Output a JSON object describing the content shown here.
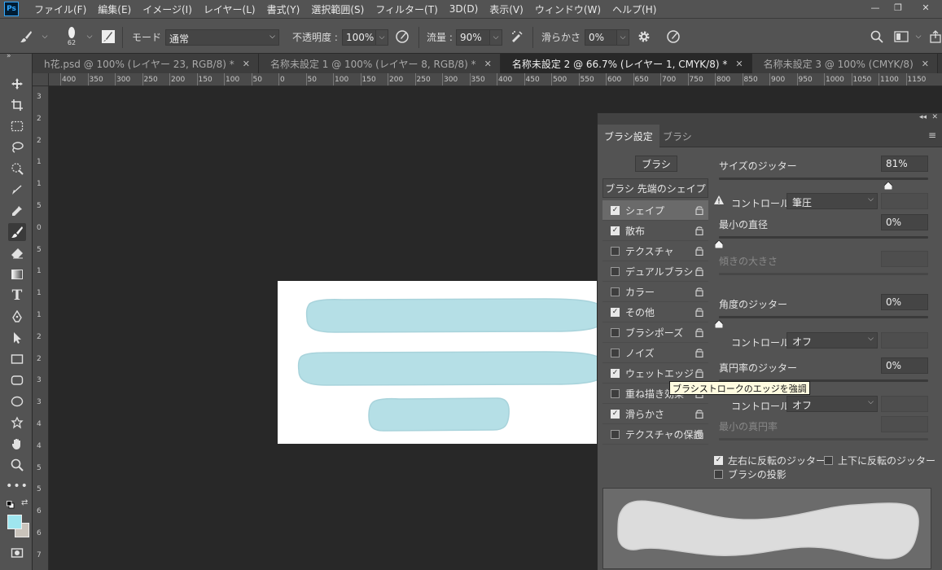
{
  "app": {
    "logo": "Ps"
  },
  "menu": [
    "ファイル(F)",
    "編集(E)",
    "イメージ(I)",
    "レイヤー(L)",
    "書式(Y)",
    "選択範囲(S)",
    "フィルター(T)",
    "3D(D)",
    "表示(V)",
    "ウィンドウ(W)",
    "ヘルプ(H)"
  ],
  "window_controls": {
    "minimize": "—",
    "restore": "❐",
    "close": "✕"
  },
  "options": {
    "brush_size": "62",
    "mode_label": "モード :",
    "mode_value": "通常",
    "opacity_label": "不透明度 :",
    "opacity_value": "100%",
    "flow_label": "流量 :",
    "flow_value": "90%",
    "smoothing_label": "滑らかさ :",
    "smoothing_value": "0%"
  },
  "tabs": [
    {
      "label": "h花.psd @ 100% (レイヤー 23, RGB/8) *",
      "active": false
    },
    {
      "label": "名称未設定 1 @ 100% (レイヤー 8, RGB/8) *",
      "active": false
    },
    {
      "label": "名称未設定 2 @ 66.7% (レイヤー 1, CMYK/8) *",
      "active": true
    },
    {
      "label": "名称未設定 3 @ 100% (CMYK/8)",
      "active": false
    }
  ],
  "ruler": {
    "h": [
      "400",
      "350",
      "300",
      "250",
      "200",
      "150",
      "100",
      "50",
      "0",
      "50",
      "100",
      "150",
      "200",
      "250",
      "300",
      "350",
      "400",
      "450",
      "500",
      "550",
      "600",
      "650",
      "700",
      "750",
      "800",
      "850",
      "900",
      "950",
      "1000",
      "1050",
      "1100",
      "1150"
    ],
    "v": [
      "3",
      "2",
      "2",
      "1",
      "1",
      "5",
      "0",
      "5",
      "1",
      "1",
      "1",
      "2",
      "2",
      "3",
      "3",
      "4",
      "4",
      "5",
      "5",
      "6",
      "6",
      "7"
    ]
  },
  "panel": {
    "tabs": [
      "ブラシ設定",
      "ブラシ"
    ],
    "brush_button": "ブラシ",
    "tip_shape": "ブラシ 先端のシェイプ",
    "options": [
      {
        "label": "シェイプ",
        "checked": true,
        "selected": true
      },
      {
        "label": "散布",
        "checked": true,
        "selected": false
      },
      {
        "label": "テクスチャ",
        "checked": false,
        "selected": false
      },
      {
        "label": "デュアルブラシ",
        "checked": false,
        "selected": false
      },
      {
        "label": "カラー",
        "checked": false,
        "selected": false
      },
      {
        "label": "その他",
        "checked": true,
        "selected": false
      },
      {
        "label": "ブラシポーズ",
        "checked": false,
        "selected": false
      },
      {
        "label": "ノイズ",
        "checked": false,
        "selected": false
      },
      {
        "label": "ウェットエッジ",
        "checked": true,
        "selected": false
      },
      {
        "label": "重ね描き効果",
        "checked": false,
        "selected": false
      },
      {
        "label": "滑らかさ",
        "checked": true,
        "selected": false
      },
      {
        "label": "テクスチャの保護",
        "checked": false,
        "selected": false
      }
    ],
    "size_jitter_label": "サイズのジッター",
    "size_jitter_value": "81%",
    "size_jitter": 0.81,
    "control_label": "コントロール :",
    "control_value_1": "筆圧",
    "min_diameter_label": "最小の直径",
    "min_diameter_value": "0%",
    "tilt_scale_label": "傾きの大きさ",
    "angle_jitter_label": "角度のジッター",
    "angle_jitter_value": "0%",
    "control_value_2": "オフ",
    "roundness_jitter_label": "真円率のジッター",
    "roundness_jitter_value": "0%",
    "control_value_3": "オフ",
    "min_roundness_label": "最小の真円率",
    "flip_x_label": "左右に反転のジッター",
    "flip_x_checked": true,
    "flip_y_label": "上下に反転のジッター",
    "flip_y_checked": false,
    "projection_label": "ブラシの投影",
    "projection_checked": false
  },
  "tooltip": "ブラシストロークのエッジを強調",
  "colors": {
    "foreground": "#9fe6ef",
    "background": "#c9c3bb",
    "stroke": "#b5dfe6"
  }
}
